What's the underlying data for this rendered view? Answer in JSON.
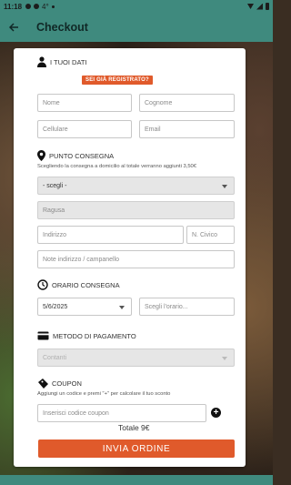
{
  "status_bar": {
    "time": "11:18",
    "indicator": "4°"
  },
  "app_bar": {
    "title": "Checkout"
  },
  "sections": {
    "user": {
      "title": "I TUOI DATI",
      "registered_badge": "SEI GIÀ REGISTRATO?"
    },
    "delivery": {
      "title": "PUNTO CONSEGNA",
      "note": "Scegliendo la consegna a domicilio al totale verranno aggiunti 3,50€"
    },
    "time": {
      "title": "ORARIO CONSEGNA"
    },
    "payment": {
      "title": "METODO DI PAGAMENTO"
    },
    "coupon": {
      "title": "COUPON",
      "note": "Aggiungi un codice e premi \"+\" per calcolare il tuo sconto"
    }
  },
  "fields": {
    "name": "Nome",
    "surname": "Cognome",
    "phone": "Cellulare",
    "email": "Email",
    "delivery_select": "- scegli -",
    "city": "Ragusa",
    "address": "Indirizzo",
    "civic": "N. Civico",
    "notes": "Note indirizzo / campanello",
    "date": "5/6/2025",
    "time": "Scegli l'orario...",
    "payment": "Contanti",
    "coupon": "Inserisci codice coupon"
  },
  "total": "Totale 9€",
  "submit_label": "INVIA ORDINE",
  "colors": {
    "primary": "#3f8a7e",
    "accent": "#e05a2b"
  }
}
